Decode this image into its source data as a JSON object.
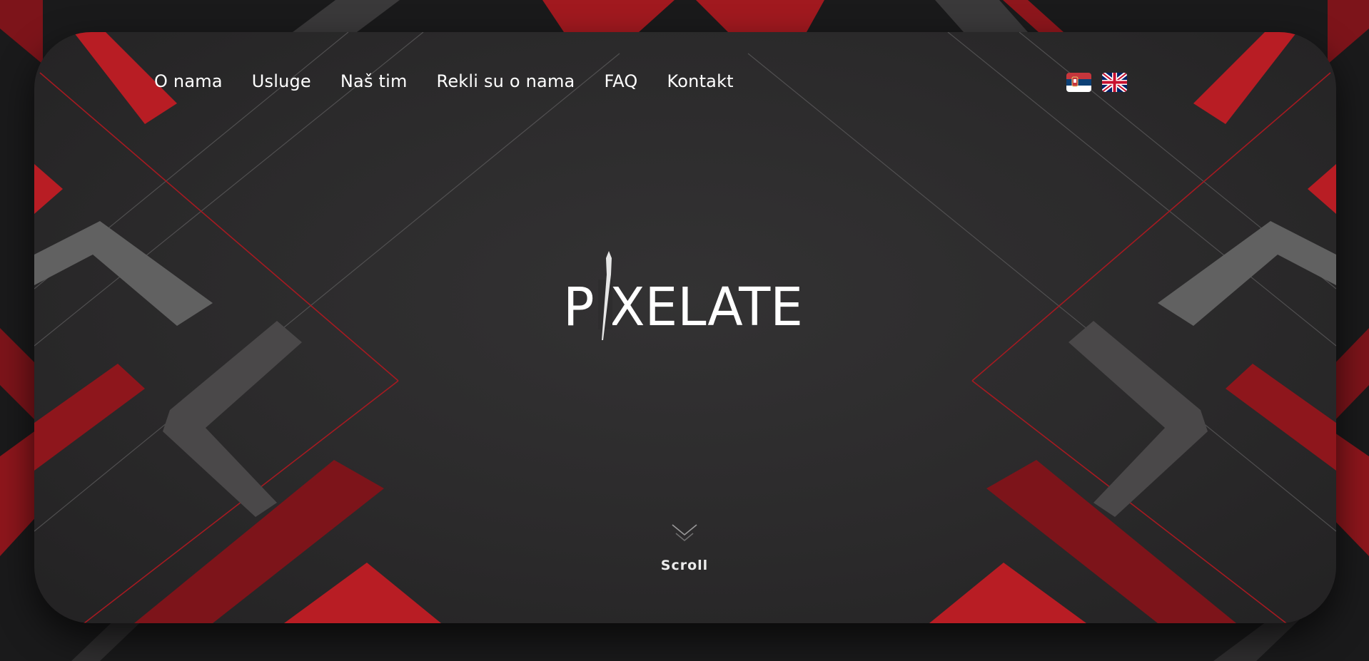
{
  "nav": {
    "items": [
      {
        "label": "O nama"
      },
      {
        "label": "Usluge"
      },
      {
        "label": "Naš tim"
      },
      {
        "label": "Rekli su o nama"
      },
      {
        "label": "FAQ"
      },
      {
        "label": "Kontakt"
      }
    ]
  },
  "languages": [
    {
      "code": "sr",
      "icon": "serbia-flag-icon"
    },
    {
      "code": "en",
      "icon": "uk-flag-icon"
    }
  ],
  "hero": {
    "logo_text": "PIXELATE",
    "scroll_label": "Scroll"
  },
  "colors": {
    "accent_red": "#b81d24",
    "dark_red": "#7d141a",
    "background": "#2e2d2e",
    "chevron_gray": "#616161",
    "text": "#ffffff"
  }
}
